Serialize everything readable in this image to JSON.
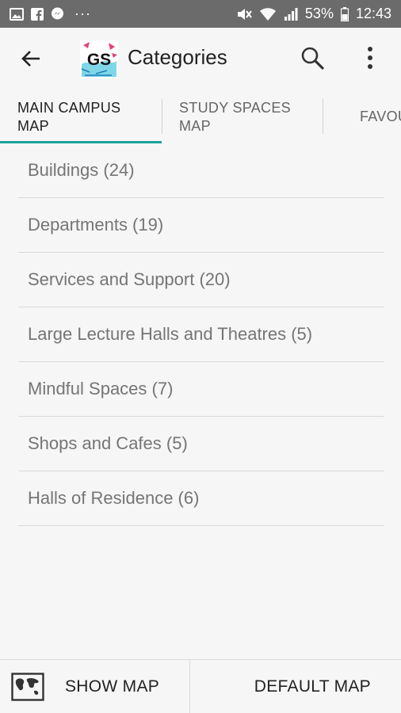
{
  "status_bar": {
    "battery": "53%",
    "time": "12:43",
    "overflow": "···"
  },
  "app_bar": {
    "title": "Categories",
    "logo_text": "GS"
  },
  "tabs": [
    {
      "label_line1": "MAIN CAMPUS",
      "label_line2": "MAP",
      "active": true
    },
    {
      "label_line1": "STUDY SPACES",
      "label_line2": "MAP",
      "active": false
    },
    {
      "label_line1": "FAVOU",
      "label_line2": "",
      "active": false
    }
  ],
  "categories": [
    {
      "label": "Buildings (24)"
    },
    {
      "label": "Departments (19)"
    },
    {
      "label": "Services and Support (20)"
    },
    {
      "label": "Large Lecture Halls and Theatres (5)"
    },
    {
      "label": "Mindful Spaces (7)"
    },
    {
      "label": "Shops and Cafes (5)"
    },
    {
      "label": "Halls of Residence (6)"
    }
  ],
  "bottom_bar": {
    "show_map": "SHOW MAP",
    "default_map": "DEFAULT MAP"
  },
  "colors": {
    "accent": "#1aa29a",
    "status_bar": "#6b6b6b"
  }
}
